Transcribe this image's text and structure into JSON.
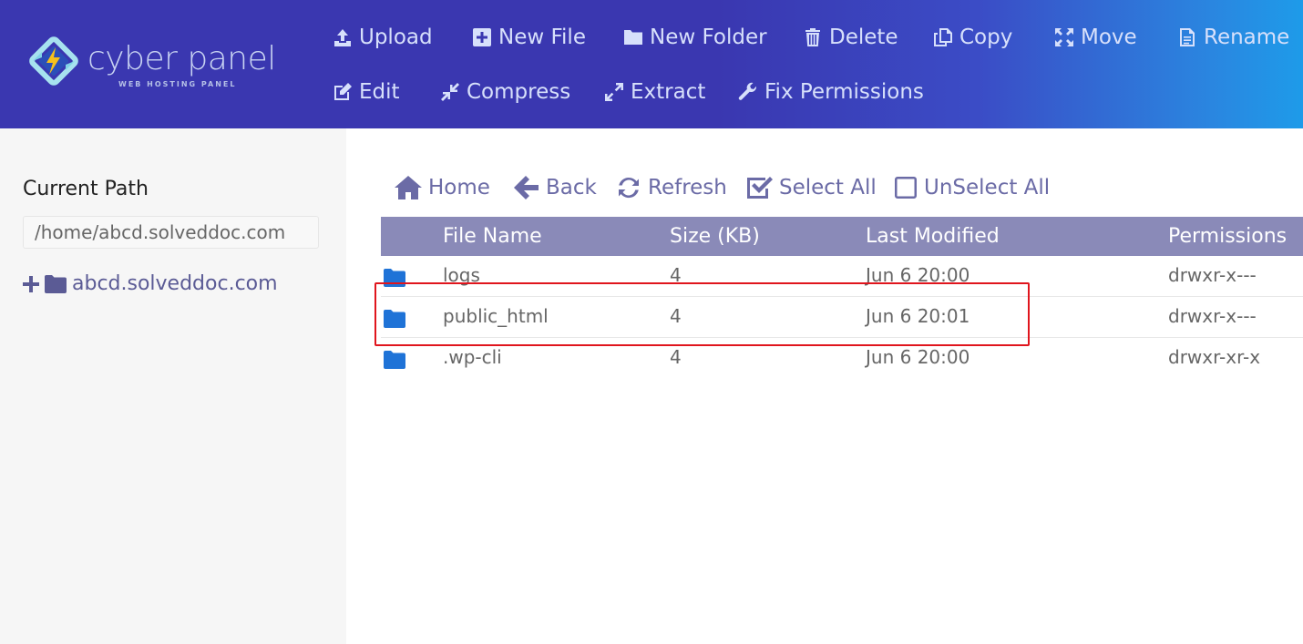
{
  "brand": {
    "name": "cyber panel",
    "tagline": "WEB HOSTING PANEL"
  },
  "toolbar": {
    "upload": "Upload",
    "new_file": "New File",
    "new_folder": "New Folder",
    "delete": "Delete",
    "copy": "Copy",
    "move": "Move",
    "rename": "Rename",
    "edit": "Edit",
    "compress": "Compress",
    "extract": "Extract",
    "fix_permissions": "Fix Permissions"
  },
  "sidebar": {
    "title": "Current Path",
    "path_value": "/home/abcd.solveddoc.com",
    "tree_root": "abcd.solveddoc.com"
  },
  "nav": {
    "home": "Home",
    "back": "Back",
    "refresh": "Refresh",
    "select_all": "Select All",
    "unselect_all": "UnSelect All"
  },
  "table": {
    "headers": {
      "name": "File Name",
      "size": "Size (KB)",
      "modified": "Last Modified",
      "permissions": "Permissions"
    },
    "rows": [
      {
        "name": "logs",
        "size": "4",
        "modified": "Jun 6 20:00",
        "permissions": "drwxr-x---"
      },
      {
        "name": "public_html",
        "size": "4",
        "modified": "Jun 6 20:01",
        "permissions": "drwxr-x---"
      },
      {
        "name": ".wp-cli",
        "size": "4",
        "modified": "Jun 6 20:00",
        "permissions": "drwxr-xr-x"
      }
    ]
  },
  "icons": {
    "upload": "upload-icon",
    "new_file": "plus-square-icon",
    "new_folder": "folder-icon",
    "delete": "trash-icon",
    "copy": "copy-icon",
    "move": "move-arrows-icon",
    "rename": "file-text-icon",
    "edit": "edit-icon",
    "compress": "compress-icon",
    "extract": "expand-icon",
    "fix_permissions": "wrench-icon",
    "home": "home-icon",
    "back": "arrow-left-icon",
    "refresh": "refresh-icon",
    "select_all": "checked-box-icon",
    "unselect_all": "empty-box-icon"
  },
  "colors": {
    "header_start": "#3a37b0",
    "header_end": "#1e9be9",
    "table_header": "#8a8ab8",
    "nav_text": "#6b6ba6",
    "folder_icon": "#1f73d7",
    "highlight": "#e0151d"
  }
}
